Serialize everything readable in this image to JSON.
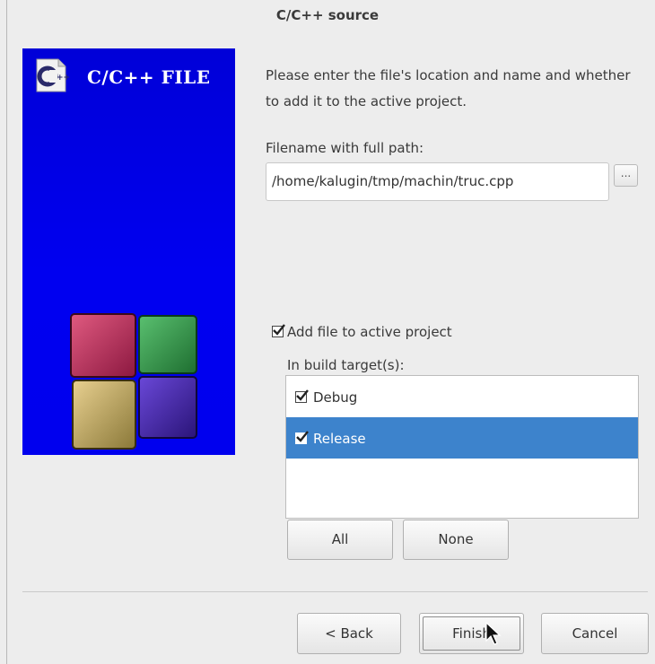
{
  "window": {
    "title": "C/C++ source"
  },
  "banner": {
    "text": "C/C++ FILE",
    "logo_icon": "cpp-file-icon"
  },
  "intro_text": "Please enter the file's location and name and whether to add it to the active project.",
  "filename": {
    "label": "Filename with full path:",
    "value": "/home/kalugin/tmp/machin/truc.cpp",
    "browse_label": "..."
  },
  "add_to_project": {
    "label": "Add file to active project",
    "checked": true
  },
  "build_targets": {
    "label": "In build target(s):",
    "items": [
      {
        "label": "Debug",
        "checked": true,
        "selected": false
      },
      {
        "label": "Release",
        "checked": true,
        "selected": true
      }
    ],
    "all_label": "All",
    "none_label": "None"
  },
  "footer": {
    "back_label": "< Back",
    "finish_label": "Finish",
    "cancel_label": "Cancel"
  },
  "colors": {
    "banner_blue": "#0000ee",
    "selection_blue": "#3d83cc"
  }
}
